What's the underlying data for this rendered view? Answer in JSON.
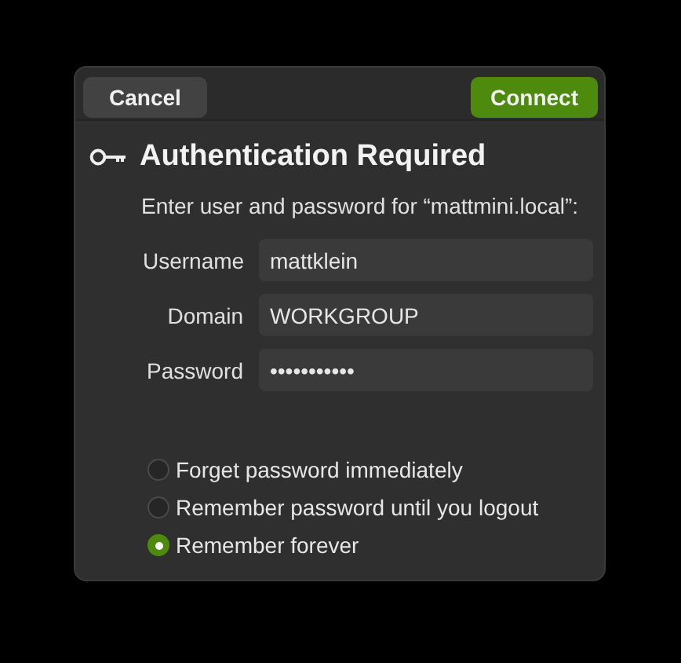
{
  "header": {
    "cancel": "Cancel",
    "connect": "Connect"
  },
  "title": "Authentication Required",
  "prompt": "Enter user and password for “mattmini.local”:",
  "fields": [
    {
      "label": "Username",
      "value": "mattklein"
    },
    {
      "label": "Domain",
      "value": "WORKGROUP"
    },
    {
      "label": "Password",
      "value": "•••••••••••"
    }
  ],
  "options": [
    {
      "label": "Forget password immediately",
      "selected": false
    },
    {
      "label": "Remember password until you logout",
      "selected": false
    },
    {
      "label": "Remember forever",
      "selected": true
    }
  ]
}
